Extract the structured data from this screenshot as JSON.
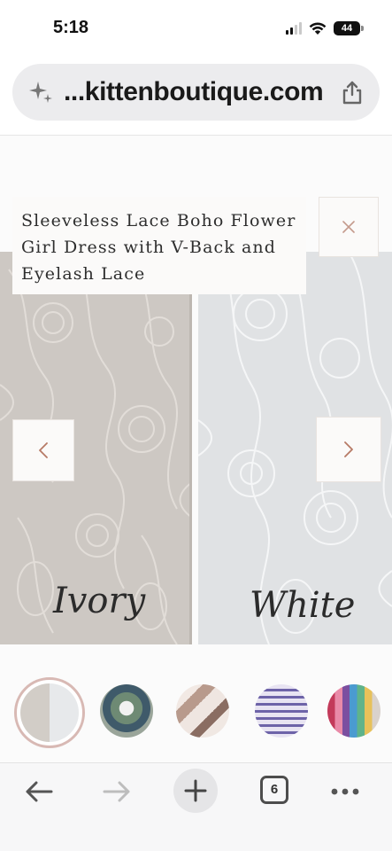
{
  "status_bar": {
    "time": "5:18",
    "battery": "44"
  },
  "browser": {
    "url": "...kittenboutique.com"
  },
  "product": {
    "title": "Sleeveless Lace Boho Flower Girl Dress with V-Back and Eyelash Lace",
    "swatches": [
      {
        "label": "Ivory",
        "color": "#cdc8c3"
      },
      {
        "label": "White",
        "color": "#e0e2e4"
      }
    ],
    "thumbnails_count": 5
  },
  "icons": {
    "close": "close-icon",
    "prev": "chevron-left-icon",
    "next": "chevron-right-icon",
    "share": "share-icon",
    "sparkle": "sparkle-icon"
  },
  "colors": {
    "arrow_accent": "#b77a66",
    "active_thumb_border": "#d8b9b4"
  }
}
